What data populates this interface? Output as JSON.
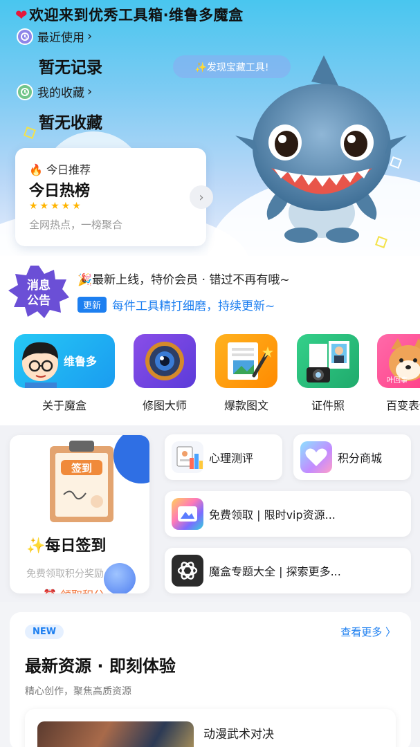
{
  "hero": {
    "title": "欢迎来到优秀工具箱·维鲁多魔盒",
    "recent_label": "最近使用",
    "recent_empty": "暂无记录",
    "favorites_label": "我的收藏",
    "favorites_empty": "暂无收藏",
    "discover_pill": "✨发现宝藏工具!",
    "recommend": {
      "tag": "今日推荐",
      "title": "今日热榜",
      "stars": "★★★★★",
      "rating": 5,
      "subtitle": "全网热点，一榜聚合"
    }
  },
  "notice": {
    "badge_text": "消息公告",
    "line1": "🎉最新上线，特价会员 · 错过不再有哦~",
    "new_tag": "更新",
    "line2": "每件工具精打细磨，持续更新~"
  },
  "tools": [
    {
      "label": "关于魔盒",
      "icon_text": "维鲁多",
      "icon": "avatar-boy-icon"
    },
    {
      "label": "修图大师",
      "icon": "camera-lens-icon"
    },
    {
      "label": "爆款图文",
      "icon": "document-magic-icon"
    },
    {
      "label": "证件照",
      "icon": "id-photo-icon"
    },
    {
      "label": "百变表情",
      "icon": "shiba-dog-icon",
      "icon_text": "叶回事"
    }
  ],
  "features": {
    "sign": {
      "board_text": "签到",
      "title": "✨每日签到",
      "subtitle": "免费领取积分奖励",
      "cta": "⏰ 领取积分"
    },
    "psych": "心理测评",
    "points": "积分商城",
    "vip": "免费领取 | 限时vip资源...",
    "topics": "魔盒专题大全 | 探索更多..."
  },
  "latest": {
    "badge": "NEW",
    "see_more": "查看更多 〉",
    "title": "最新资源 · 即刻体验",
    "subtitle": "精心创作，聚焦高质资源",
    "items": [
      {
        "title": "动漫武术对决"
      }
    ]
  }
}
